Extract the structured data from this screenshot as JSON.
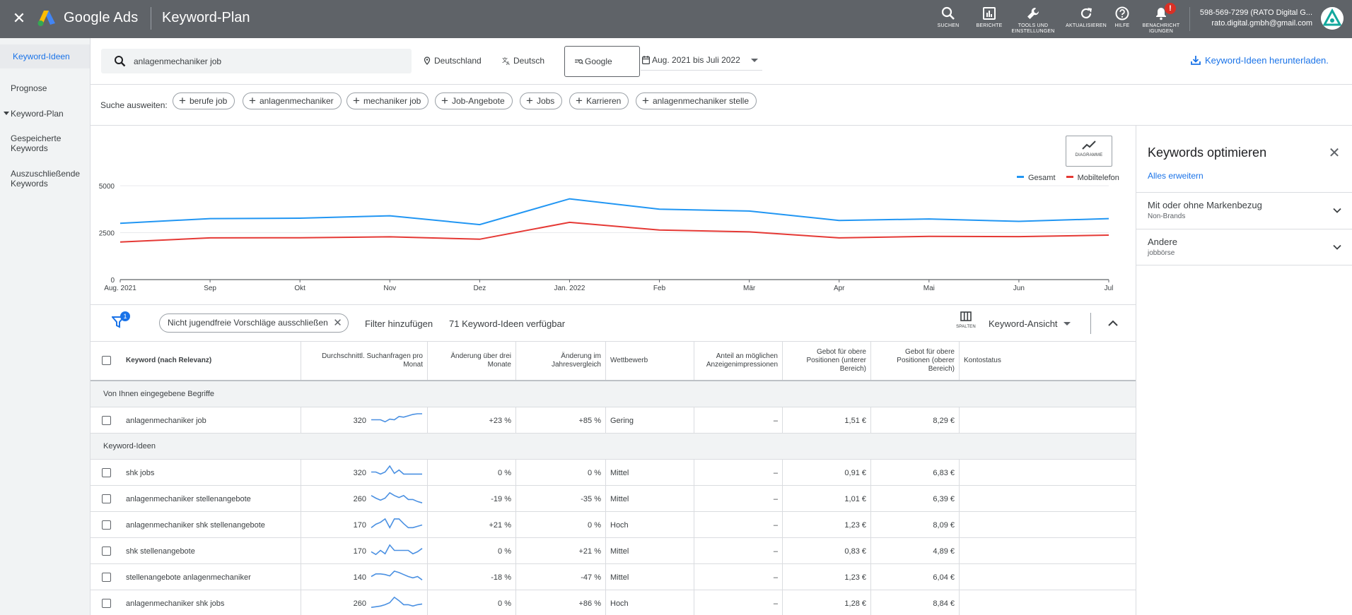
{
  "topbar": {
    "brand": "Google Ads",
    "title": "Keyword-Plan",
    "tools": [
      {
        "label": "SUCHEN",
        "icon": "search-icon"
      },
      {
        "label": "BERICHTE",
        "icon": "reports-icon"
      },
      {
        "label": "TOOLS UND EINSTELLUNGEN",
        "icon": "wrench-icon"
      },
      {
        "label": "AKTUALISIEREN",
        "icon": "refresh-icon"
      },
      {
        "label": "HILFE",
        "icon": "help-icon"
      },
      {
        "label": "BENACHRICHT IGUNGEN",
        "icon": "bell-icon",
        "badge": "!"
      }
    ],
    "account_line1": "598-569-7299 (RATO Digital G...",
    "account_line2": "rato.digital.gmbh@gmail.com"
  },
  "leftnav": {
    "items": [
      {
        "label": "Keyword-Ideen"
      },
      {
        "label": "Prognose"
      },
      {
        "label": "Keyword-Plan"
      },
      {
        "label": "Gespeicherte Keywords"
      },
      {
        "label": "Auszuschließende Keywords"
      }
    ]
  },
  "search": {
    "value": "anlagenmechaniker job",
    "location": "Deutschland",
    "language": "Deutsch",
    "network": "Google",
    "date_range": "Aug. 2021 bis Juli 2022",
    "download_label": "Keyword-Ideen herunterladen."
  },
  "expand": {
    "label": "Suche ausweiten:",
    "chips": [
      "berufe job",
      "anlagenmechaniker",
      "mechaniker job",
      "Job-Angebote",
      "Jobs",
      "Karrieren",
      "anlagenmechaniker stelle"
    ]
  },
  "chart": {
    "button_label": "DIAGRAMME",
    "legend": [
      "Gesamt",
      "Mobiltelefon"
    ],
    "colors": {
      "total": "#2196f3",
      "mobile": "#e53935"
    }
  },
  "chart_data": {
    "type": "line",
    "x": [
      "Aug. 2021",
      "Sep",
      "Okt",
      "Nov",
      "Dez",
      "Jan. 2022",
      "Feb",
      "Mär",
      "Apr",
      "Mai",
      "Jun",
      "Jul"
    ],
    "series": [
      {
        "name": "Gesamt",
        "values": [
          3000,
          3250,
          3270,
          3400,
          2930,
          4300,
          3750,
          3650,
          3150,
          3230,
          3100,
          3250
        ]
      },
      {
        "name": "Mobiltelefon",
        "values": [
          2000,
          2220,
          2230,
          2280,
          2150,
          3050,
          2640,
          2540,
          2220,
          2300,
          2290,
          2370
        ]
      }
    ],
    "yticks": [
      0,
      2500,
      5000
    ],
    "ylim": [
      0,
      5000
    ]
  },
  "filterbar": {
    "filter_count": "1",
    "filter_chip": "Nicht jugendfreie Vorschläge ausschließen",
    "add_filter": "Filter hinzufügen",
    "available": "71 Keyword-Ideen verfügbar",
    "columns_label": "SPALTEN",
    "view_label": "Keyword-Ansicht"
  },
  "table": {
    "headers": [
      "Keyword (nach Relevanz)",
      "Durchschnittl. Suchanfragen pro Monat",
      "Änderung über drei Monate",
      "Änderung im Jahresvergleich",
      "Wettbewerb",
      "Anteil an möglichen Anzeigenimpressionen",
      "Gebot für obere Positionen (unterer Bereich)",
      "Gebot für obere Positionen (oberer Bereich)",
      "Kontostatus"
    ],
    "group_entered": "Von Ihnen eingegebene Begriffe",
    "group_ideas": "Keyword-Ideen",
    "entered_rows": [
      {
        "keyword": "anlagenmechaniker job",
        "searches": "320",
        "three_month": "+23 %",
        "yoy": "+85 %",
        "competition": "Gering",
        "share": "–",
        "bid_low": "1,51 €",
        "bid_high": "8,29 €",
        "spark": [
          0.55,
          0.55,
          0.55,
          0.4,
          0.6,
          0.55,
          0.8,
          0.75,
          0.85,
          0.95,
          1.0,
          1.0
        ]
      }
    ],
    "idea_rows": [
      {
        "keyword": "shk jobs",
        "searches": "320",
        "three_month": "0 %",
        "yoy": "0 %",
        "competition": "Mittel",
        "share": "–",
        "bid_low": "0,91 €",
        "bid_high": "6,83 €",
        "spark": [
          0.55,
          0.55,
          0.4,
          0.55,
          1.0,
          0.45,
          0.7,
          0.4,
          0.4,
          0.4,
          0.4,
          0.4
        ]
      },
      {
        "keyword": "anlagenmechaniker stellenangebote",
        "searches": "260",
        "three_month": "-19 %",
        "yoy": "-35 %",
        "competition": "Mittel",
        "share": "–",
        "bid_low": "1,01 €",
        "bid_high": "6,39 €",
        "spark": [
          0.75,
          0.55,
          0.4,
          0.55,
          0.95,
          0.75,
          0.6,
          0.75,
          0.45,
          0.45,
          0.3,
          0.2
        ]
      },
      {
        "keyword": "anlagenmechaniker shk stellenangebote",
        "searches": "170",
        "three_month": "+21 %",
        "yoy": "0 %",
        "competition": "Hoch",
        "share": "–",
        "bid_low": "1,23 €",
        "bid_high": "8,09 €",
        "spark": [
          0.3,
          0.55,
          0.7,
          0.95,
          0.3,
          0.95,
          0.95,
          0.6,
          0.3,
          0.3,
          0.4,
          0.5
        ]
      },
      {
        "keyword": "shk stellenangebote",
        "searches": "170",
        "three_month": "0 %",
        "yoy": "+21 %",
        "competition": "Mittel",
        "share": "–",
        "bid_low": "0,83 €",
        "bid_high": "4,89 €",
        "spark": [
          0.45,
          0.25,
          0.55,
          0.3,
          0.95,
          0.55,
          0.55,
          0.55,
          0.55,
          0.3,
          0.45,
          0.7
        ]
      },
      {
        "keyword": "stellenangebote anlagenmechaniker",
        "searches": "140",
        "three_month": "-18 %",
        "yoy": "-47 %",
        "competition": "Mittel",
        "share": "–",
        "bid_low": "1,23 €",
        "bid_high": "6,04 €",
        "spark": [
          0.55,
          0.75,
          0.75,
          0.7,
          0.6,
          0.95,
          0.85,
          0.7,
          0.55,
          0.45,
          0.55,
          0.3
        ]
      },
      {
        "keyword": "anlagenmechaniker shk jobs",
        "searches": "260",
        "three_month": "0 %",
        "yoy": "+86 %",
        "competition": "Hoch",
        "share": "–",
        "bid_low": "1,28 €",
        "bid_high": "8,84 €",
        "spark": [
          0.2,
          0.25,
          0.3,
          0.4,
          0.55,
          0.95,
          0.7,
          0.4,
          0.4,
          0.3,
          0.4,
          0.45
        ]
      }
    ]
  },
  "rightpanel": {
    "title": "Keywords optimieren",
    "expand_all": "Alles erweitern",
    "sections": [
      {
        "title": "Mit oder ohne Markenbezug",
        "subtitle": "Non-Brands"
      },
      {
        "title": "Andere",
        "subtitle": "jobbörse"
      }
    ]
  }
}
